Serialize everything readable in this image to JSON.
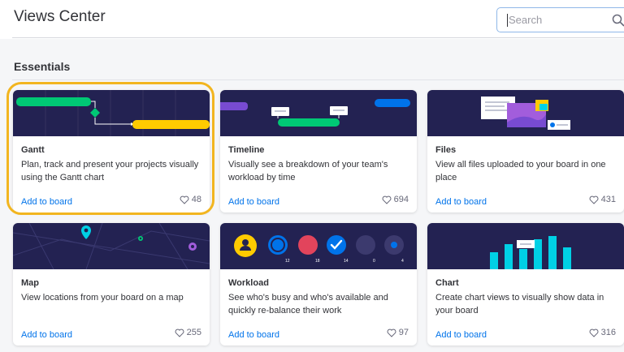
{
  "header": {
    "title": "Views Center",
    "search_placeholder": "Search"
  },
  "section": {
    "title": "Essentials"
  },
  "cards": [
    {
      "name": "Gantt",
      "description": "Plan, track and present your projects visually using the Gantt chart",
      "action": "Add to board",
      "likes": "48",
      "icon": "gantt-illustration"
    },
    {
      "name": "Timeline",
      "description": "Visually see a breakdown of your team's workload by time",
      "action": "Add to board",
      "likes": "694",
      "icon": "timeline-illustration"
    },
    {
      "name": "Files",
      "description": "View all files uploaded to your board in one place",
      "action": "Add to board",
      "likes": "431",
      "icon": "files-illustration"
    },
    {
      "name": "Map",
      "description": "View locations from your board on a map",
      "action": "Add to board",
      "likes": "255",
      "icon": "map-illustration"
    },
    {
      "name": "Workload",
      "description": "See who's busy and who's available and quickly re-balance their work",
      "action": "Add to board",
      "likes": "97",
      "icon": "workload-illustration",
      "banner_numbers": [
        "12",
        "18",
        "14",
        "0",
        "4"
      ]
    },
    {
      "name": "Chart",
      "description": "Create chart views to visually show data in your board",
      "action": "Add to board",
      "likes": "316",
      "icon": "chart-illustration"
    }
  ],
  "colors": {
    "banner_bg": "#232252",
    "link": "#0073ea",
    "highlight": "#f2b51f",
    "green": "#00c875",
    "yellow": "#ffcb00",
    "purple": "#a25ddc",
    "blue": "#0073ea",
    "cyan": "#00d0e5"
  }
}
